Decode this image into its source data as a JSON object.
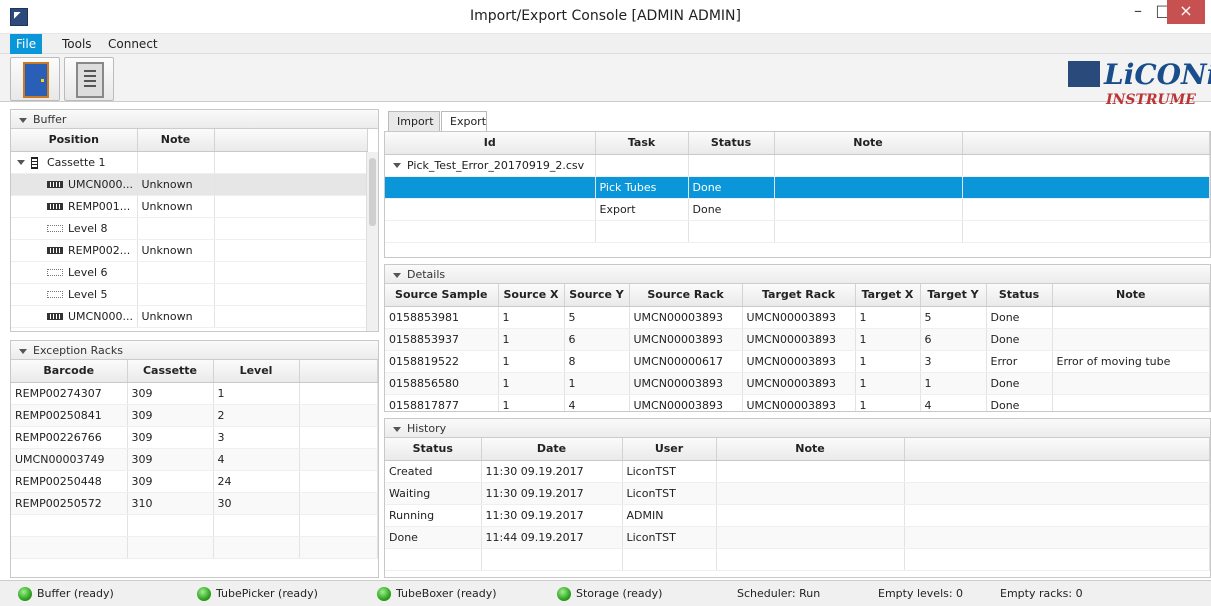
{
  "window": {
    "title": "Import/Export Console [ADMIN ADMIN]",
    "min": "–",
    "max": "□",
    "close": "×"
  },
  "menu": [
    "File",
    "Tools",
    "Connect"
  ],
  "logo": {
    "text": "LiCONi",
    "sub": "INSTRUME"
  },
  "buffer": {
    "title": "Buffer",
    "columns": [
      "Position",
      "Note"
    ],
    "cassette": "Cassette 1",
    "rows": [
      {
        "position": "UMCN000...",
        "note": "Unknown",
        "icon": "rack-icon"
      },
      {
        "position": "REMP001...",
        "note": "Unknown",
        "icon": "rack-icon"
      },
      {
        "position": "Level 8",
        "note": "",
        "icon": "empty-level-icon"
      },
      {
        "position": "REMP002...",
        "note": "Unknown",
        "icon": "rack-icon"
      },
      {
        "position": "Level 6",
        "note": "",
        "icon": "empty-level-icon"
      },
      {
        "position": "Level 5",
        "note": "",
        "icon": "empty-level-icon"
      },
      {
        "position": "UMCN000...",
        "note": "Unknown",
        "icon": "rack-icon"
      }
    ]
  },
  "exception": {
    "title": "Exception Racks",
    "columns": [
      "Barcode",
      "Cassette",
      "Level"
    ],
    "rows": [
      [
        "REMP00274307",
        "309",
        "1"
      ],
      [
        "REMP00250841",
        "309",
        "2"
      ],
      [
        "REMP00226766",
        "309",
        "3"
      ],
      [
        "UMCN00003749",
        "309",
        "4"
      ],
      [
        "REMP00250448",
        "309",
        "24"
      ],
      [
        "REMP00250572",
        "310",
        "30"
      ]
    ]
  },
  "tabs": [
    "Import",
    "Export"
  ],
  "tasks": {
    "columns": [
      "Id",
      "Task",
      "Status",
      "Note"
    ],
    "file": "Pick_Test_Error_20170919_2.csv",
    "rows": [
      [
        "",
        "Pick Tubes",
        "Done",
        ""
      ],
      [
        "",
        "Export",
        "Done",
        ""
      ]
    ]
  },
  "details": {
    "title": "Details",
    "columns": [
      "Source Sample",
      "Source X",
      "Source Y",
      "Source Rack",
      "Target Rack",
      "Target X",
      "Target Y",
      "Status",
      "Note"
    ],
    "rows": [
      [
        "0158853981",
        "1",
        "5",
        "UMCN00003893",
        "UMCN00003893",
        "1",
        "5",
        "Done",
        ""
      ],
      [
        "0158853937",
        "1",
        "6",
        "UMCN00003893",
        "UMCN00003893",
        "1",
        "6",
        "Done",
        ""
      ],
      [
        "0158819522",
        "1",
        "8",
        "UMCN00000617",
        "UMCN00003893",
        "1",
        "3",
        "Error",
        "Error of moving tube"
      ],
      [
        "0158856580",
        "1",
        "1",
        "UMCN00003893",
        "UMCN00003893",
        "1",
        "1",
        "Done",
        ""
      ],
      [
        "0158817877",
        "1",
        "4",
        "UMCN00003893",
        "UMCN00003893",
        "1",
        "4",
        "Done",
        ""
      ]
    ]
  },
  "history": {
    "title": "History",
    "columns": [
      "Status",
      "Date",
      "User",
      "Note"
    ],
    "rows": [
      [
        "Created",
        "11:30 09.19.2017",
        "LiconTST",
        ""
      ],
      [
        "Waiting",
        "11:30 09.19.2017",
        "LiconTST",
        ""
      ],
      [
        "Running",
        "11:30 09.19.2017",
        "ADMIN",
        ""
      ],
      [
        "Done",
        "11:44 09.19.2017",
        "LiconTST",
        ""
      ]
    ]
  },
  "status": {
    "buffer": "Buffer (ready)",
    "tubepicker": "TubePicker (ready)",
    "tubeboxer": "TubeBoxer (ready)",
    "storage": "Storage (ready)",
    "scheduler": "Scheduler: Run",
    "empty_levels": "Empty levels: 0",
    "empty_racks": "Empty racks: 0"
  },
  "colors": {
    "selection": "#0a96d8",
    "close": "#c75050",
    "led": "#2ea31e"
  }
}
